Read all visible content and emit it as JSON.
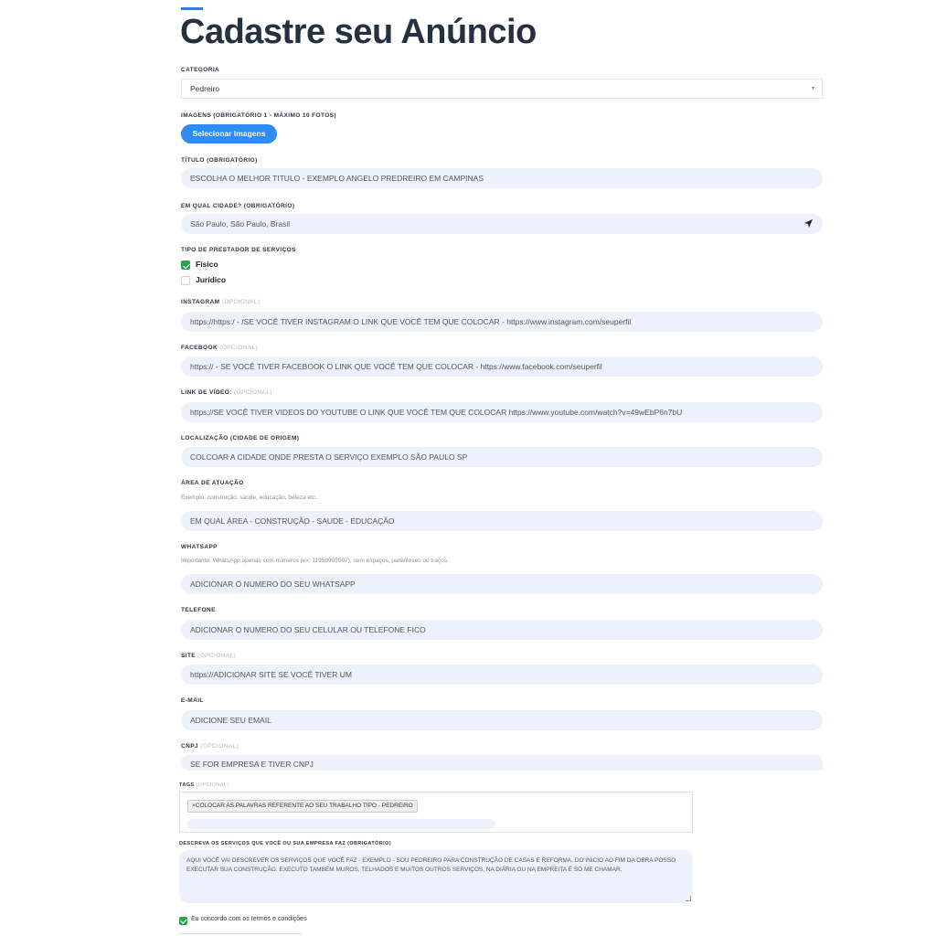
{
  "page": {
    "title": "Cadastre seu Anúncio"
  },
  "categoria": {
    "label": "CATEGORIA",
    "value": "Pedreiro"
  },
  "imagens": {
    "label": "IMAGENS (OBRIGATÓRIO 1 - MÁXIMO 10 FOTOS)",
    "button": "Selecionar Imagens"
  },
  "titulo": {
    "label": "TÍTULO (OBRIGATÓRIO)",
    "value": "ESCOLHA O MELHOR TITULO - EXEMPLO ANGELO PREDREIRO EM CAMPINAS"
  },
  "cidade": {
    "label": "EM QUAL CIDADE? (OBRIGATÓRIO)",
    "value": "São Paulo, São Paulo, Brasil"
  },
  "prestador": {
    "label": "TIPO DE PRESTADOR DE SERVIÇOS",
    "options": [
      {
        "label": "Físico",
        "checked": true
      },
      {
        "label": "Jurídico",
        "checked": false
      }
    ]
  },
  "instagram": {
    "label": "INSTAGRAM",
    "opt": "(OPCIONAL)",
    "value": "https://https:/    -   /SE VOCÊ TIVER INSTAGRAM O LINK QUE VOCÊ TEM QUE COLOCAR - https://www.instagram.com/seuperfil"
  },
  "facebook": {
    "label": "FACEBOOK",
    "opt": "(OPCIONAL)",
    "value": "https://   -   SE VOCÊ TIVER FACEBOOK O LINK QUE VOCÊ TEM QUE COLOCAR - https://www.facebook.com/seuperfil"
  },
  "video": {
    "label": "LINK DE VÍDEO:",
    "opt": "(OPCIONAL)",
    "value": "https://SE VOCÊ TIVER VIDEOS DO YOUTUBE  O LINK QUE VOCÊ TEM QUE COLOCAR  https://www.youtube.com/watch?v=49wEbP6n7bU"
  },
  "localizacao": {
    "label": "LOCALIZAÇÃO (CIDADE DE ORIGEM)",
    "value": "COLCOAR A CIDADE ONDE PRESTA O SERVIÇO EXEMPLO SÃO PAULO SP"
  },
  "area": {
    "label": "ÁREA DE ATUAÇÃO",
    "hint": "Exemplo: construção, saúde, educação, beleza etc.",
    "value": "EM QUAL ÁREA - CONSTRUÇÃO - SAUDE - EDUCAÇÃO"
  },
  "whatsapp": {
    "label": "WHATSAPP",
    "hint": "Importante: WhatsApp apenas com números (ex: 11959905507), sem espaços, parênteses ou traços.",
    "value": "ADICIONAR O NUMERO DO SEU WHATSAPP"
  },
  "telefone": {
    "label": "TELEFONE",
    "value": "ADICIONAR O NUMERO DO SEU CELULAR OU TELEFONE FICO"
  },
  "site": {
    "label": "SITE",
    "opt": "(OPCIONAL)",
    "value": "https://ADICIONAR SITE SE VOCÊ TIVER UM"
  },
  "email": {
    "label": "E-MAIL",
    "value": "ADICIONE SEU EMAIL"
  },
  "cnpj": {
    "label": "CNPJ",
    "opt": "(OPCIONAL)",
    "value": "SE FOR EMPRESA E TIVER CNPJ"
  },
  "tags": {
    "label": "TAGS",
    "opt": "(OPCIONAL)",
    "chip": "×COLOCAR AS PALAVRAS REFERENTE AO SEU TRABALHO TIPO - PEDREIRO"
  },
  "descricao": {
    "label": "DESCREVA OS SERVIÇOS QUE VOCÊ OU SUA EMPRESA FAZ (OBRIGATÓRIO)",
    "value": "AQUI VOCÊ VAI DESCREVER OS SERVIÇOS QUE VOCÊ FAZ - EXEMPLO - SOU PEDREIRO PARA CONSTRUÇÃO DE CASAS E REFORMA, DO INICIO AO FIM DA OBRA POSSO EXECUTAR SUA CONSTRUÇÃO. EXECUTO TAMBÉM MUROS, TELHADOS E MUITOS OUTROS SERVIÇOS, NA DIÁRIA OU NA EMPREITA É SÓ ME CHAMAR."
  },
  "terms": {
    "label": "Eu concordo com os termos e condições",
    "checked": true
  },
  "colors": {
    "accent": "#2f8cf0",
    "input_bg": "#edf1fb",
    "check": "#2ea44f",
    "title": "#253041"
  }
}
